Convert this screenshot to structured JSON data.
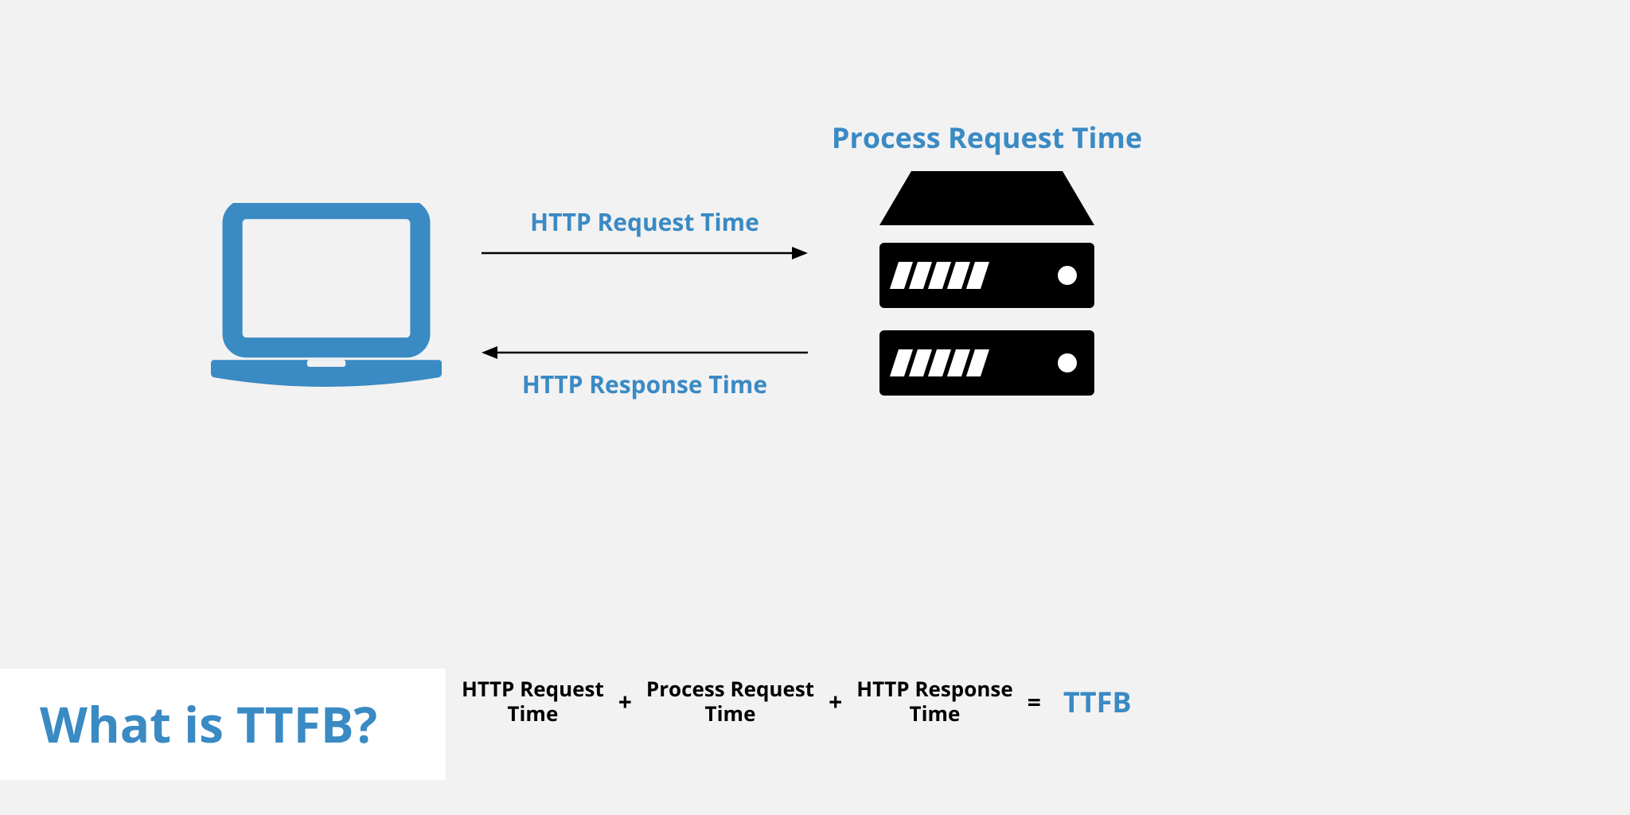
{
  "server_label": "Process Request Time",
  "arrow_request": "HTTP Request Time",
  "arrow_response": "HTTP Response Time",
  "title": "What is TTFB?",
  "equation": {
    "term1_l1": "HTTP Request",
    "term1_l2": "Time",
    "term2_l1": "Process Request",
    "term2_l2": "Time",
    "term3_l1": "HTTP Response",
    "term3_l2": "Time",
    "plus": "+",
    "equals": "=",
    "result": "TTFB"
  },
  "colors": {
    "accent": "#3a8ac4",
    "bg": "#f2f2f2"
  }
}
